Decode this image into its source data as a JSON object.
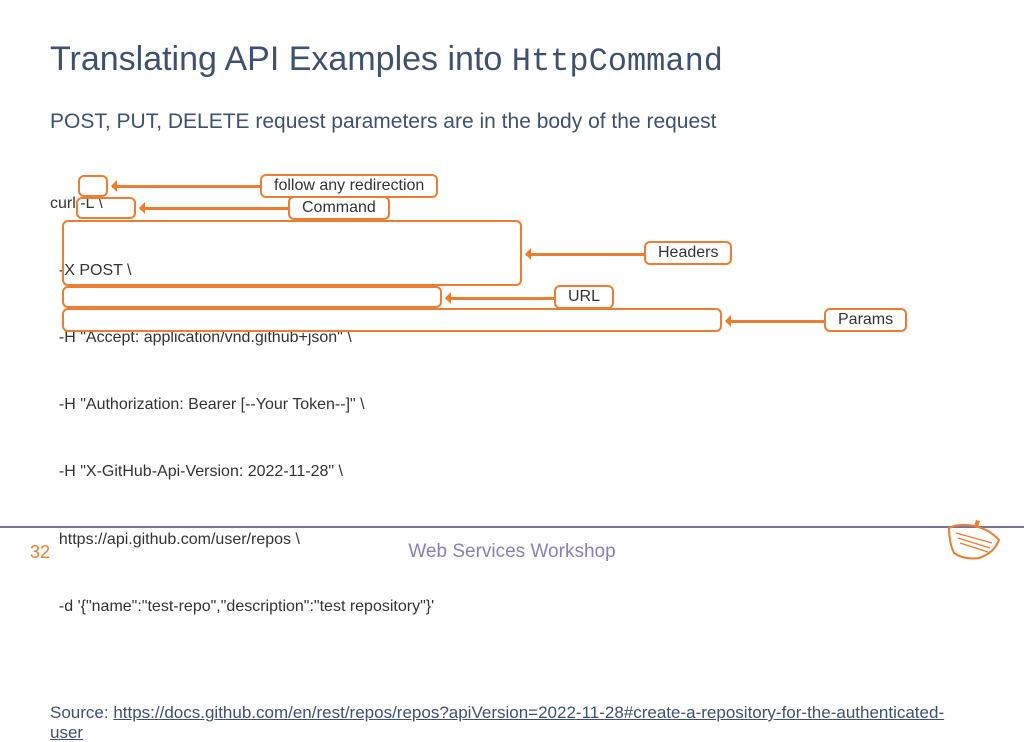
{
  "title_prefix": "Translating API Examples into ",
  "title_mono": "HttpCommand",
  "subhead": "POST, PUT, DELETE request parameters are in the body of the request",
  "code": {
    "l1": "curl -L \\",
    "l2": "  -X POST \\",
    "l3": "  -H \"Accept: application/vnd.github+json\" \\",
    "l4": "  -H \"Authorization: Bearer [--Your Token--]\" \\",
    "l5": "  -H \"X-GitHub-Api-Version: 2022-11-28\" \\",
    "l6": "  https://api.github.com/user/repos \\",
    "l7": "  -d '{\"name\":\"test-repo\",\"description\":\"test repository\"}'"
  },
  "labels": {
    "redirect": "follow any redirection",
    "command": "Command",
    "headers": "Headers",
    "url": "URL",
    "params": "Params"
  },
  "source_prefix": "Source: ",
  "source_link": "https://docs.github.com/en/rest/repos/repos?apiVersion=2022-11-28#create-a-repository-for-the-authenticated-user",
  "footer": {
    "page": "32",
    "title": "Web Services Workshop"
  }
}
